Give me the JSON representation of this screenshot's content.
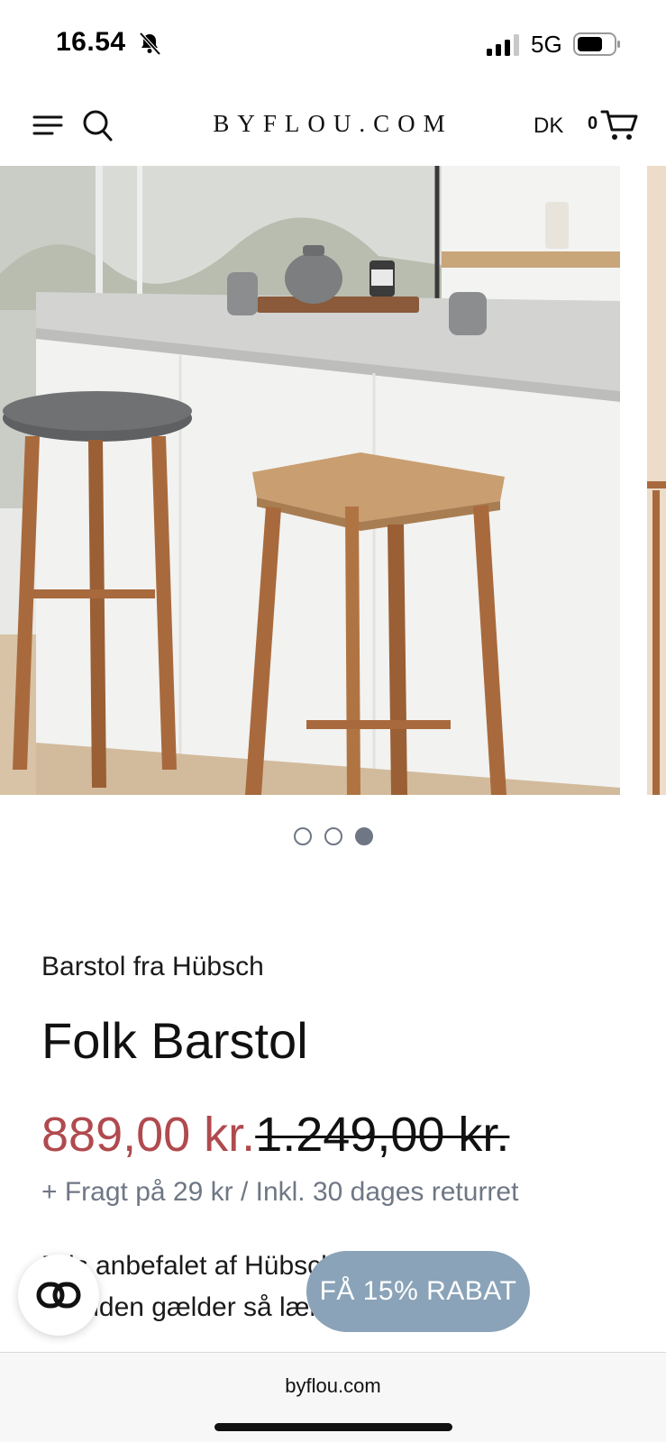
{
  "status_bar": {
    "time": "16.54",
    "network": "5G",
    "icons": [
      "bell-slash-icon",
      "signal-icon",
      "battery-icon"
    ]
  },
  "header": {
    "logo": "BYFLOU.COM",
    "language": "DK",
    "cart_count": "0",
    "icons": [
      "menu-icon",
      "search-icon",
      "cart-icon"
    ]
  },
  "gallery": {
    "slide_count": 3,
    "active_slide": 3
  },
  "product": {
    "brand_line": "Barstol fra Hübsch",
    "title": "Folk Barstol",
    "price_sale": "889,00 kr.",
    "price_old": "1.249,00 kr.",
    "shipping": "+ Fragt på 29 kr / Inkl. 30 dages returret",
    "description_line1": "Pris anbefalet af Hübsch",
    "description_line2": "Tilbuden gælder så længe"
  },
  "widgets": {
    "discount_label": "FÅ 15% RABAT",
    "chat_icon": "chat-link-icon"
  },
  "browser": {
    "url": "byflou.com"
  },
  "colors": {
    "sale_price": "#b04a4e",
    "muted_text": "#6f7785",
    "discount_button": "#8aa3b8"
  }
}
